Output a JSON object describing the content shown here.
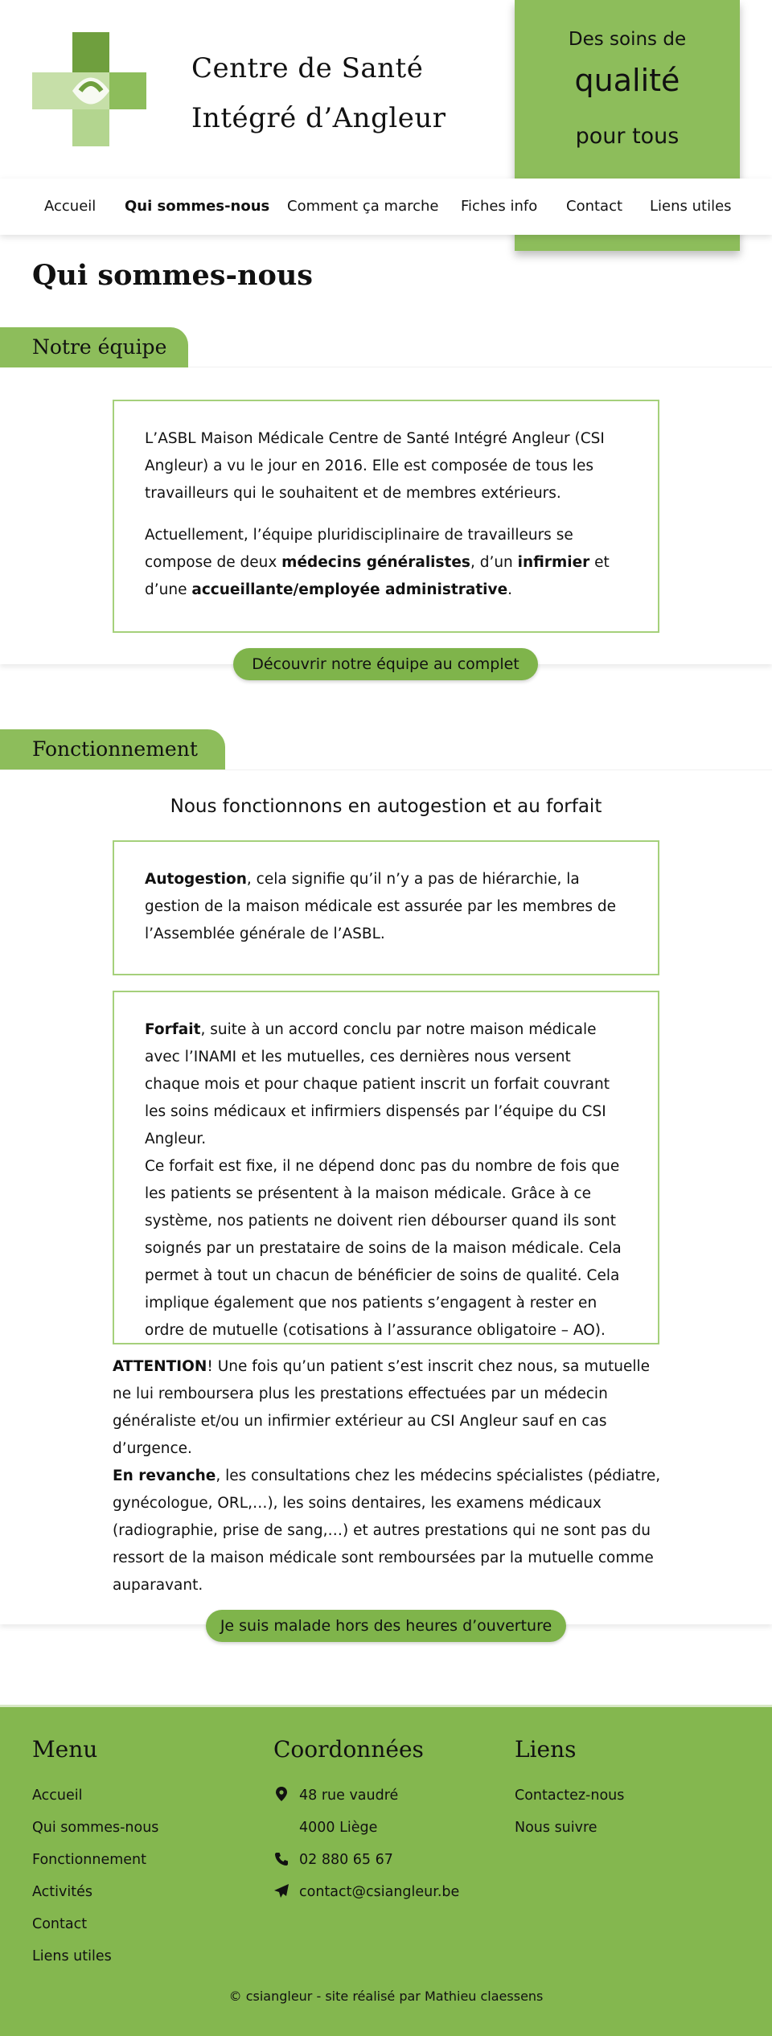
{
  "header": {
    "title_line1": "Centre de Santé",
    "title_line2": "Intégré d’Angleur",
    "tagline_line1": "Des soins de",
    "tagline_line2": "qualité",
    "tagline_line3": "pour tous",
    "colors": {
      "green": "#8dbd5b",
      "green_dark": "#6a9a3a",
      "green_light": "#c6dfa8"
    }
  },
  "nav": {
    "items": [
      {
        "label": "Accueil"
      },
      {
        "label": "Qui sommes-nous"
      },
      {
        "label": "Comment ça marche"
      },
      {
        "label": "Fiches info"
      },
      {
        "label": "Contact"
      },
      {
        "label": "Liens utiles"
      }
    ],
    "active": "Qui sommes-nous"
  },
  "page": {
    "title": "Qui sommes-nous"
  },
  "equipe": {
    "heading": "Notre équipe",
    "p1": "L’ASBL Maison Médicale Centre de Santé Intégré Angleur (CSI Angleur) a vu le jour en 2016. Elle est composée de tous les travailleurs qui le souhaitent et de membres extérieurs.",
    "p2_a": "Actuellement, l’équipe pluridisciplinaire de travailleurs se compose de deux ",
    "p2_b": "médecins généralistes",
    "p2_c": ", d’un ",
    "p2_d": "infirmier",
    "p2_e": " et d’une ",
    "p2_f": "accueillante/employée administrative",
    "p2_g": ".",
    "button": "Découvrir notre équipe au complet"
  },
  "fonctionnement": {
    "heading": "Fonctionnement",
    "subtitle": "Nous fonctionnons en autogestion et au forfait",
    "auto_bold": "Autogestion",
    "auto_text": ", cela signifie qu’il n’y a pas de hiérarchie, la gestion de la maison médicale est assurée par les membres de l’Assemblée générale de l’ASBL.",
    "forfait_bold": "Forfait",
    "forfait_text1": ", suite à un accord conclu par notre maison médicale avec l’INAMI et les mutuelles, ces dernières nous versent chaque mois et pour chaque patient inscrit un forfait couvrant les soins médicaux et infirmiers dispensés par l’équipe du CSI Angleur.",
    "forfait_text2": "Ce forfait est fixe, il ne dépend donc pas du nombre de fois que les patients se présentent à la maison médicale. Grâce à ce système, nos patients ne doivent rien débourser quand ils sont soignés par un prestataire de soins de la maison médicale. Cela permet à tout un chacun de bénéficier de soins de qualité. Cela implique également que nos patients s’engagent à rester en ordre de mutuelle (cotisations à l’assurance obligatoire – AO).",
    "attention_bold": "ATTENTION",
    "attention_text": "! Une fois qu’un patient s’est inscrit chez nous, sa mutuelle ne lui remboursera plus les prestations effectuées par un médecin généraliste et/ou un infirmier extérieur au CSI Angleur sauf en cas d’urgence.",
    "revanche_bold": "En revanche",
    "revanche_text": ", les consultations chez les médecins spécialistes (pédiatre, gynécologue, ORL,…), les soins dentaires, les examens médicaux (radiographie, prise de sang,…) et autres prestations qui ne sont pas du ressort de la maison médicale sont remboursées par la mutuelle comme auparavant.",
    "button": "Je suis malade hors des heures d’ouverture"
  },
  "footer": {
    "menu_title": "Menu",
    "menu": [
      {
        "label": "Accueil"
      },
      {
        "label": "Qui sommes-nous"
      },
      {
        "label": "Fonctionnement"
      },
      {
        "label": "Activités"
      },
      {
        "label": "Contact"
      },
      {
        "label": "Liens utiles"
      }
    ],
    "coord_title": "Coordonnées",
    "address_line1": "48 rue vaudré",
    "address_line2": "4000 Liège",
    "phone": "02 880 65 67",
    "email": "contact@csiangleur.be",
    "liens_title": "Liens",
    "liens": [
      {
        "label": "Contactez-nous"
      },
      {
        "label": "Nous suivre"
      }
    ],
    "copyright": "© csiangleur - site réalisé par Mathieu claessens",
    "icons": [
      "map-pin-icon",
      "phone-icon",
      "paper-plane-icon"
    ]
  }
}
